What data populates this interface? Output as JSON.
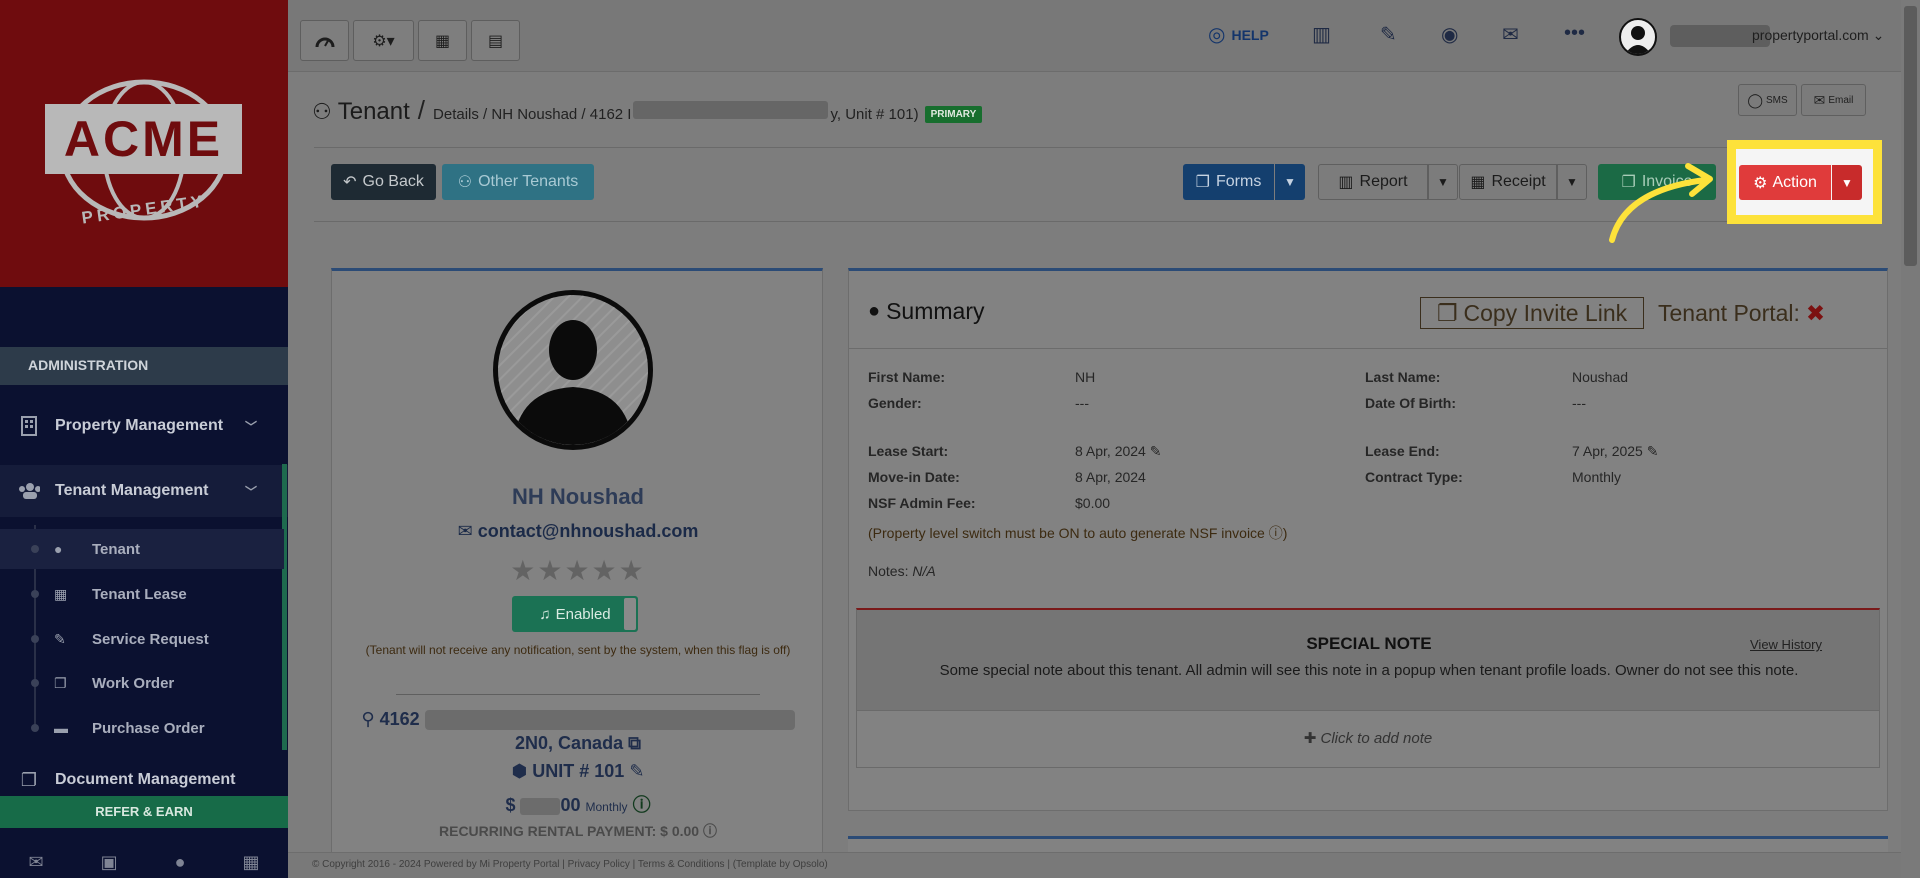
{
  "sidebar": {
    "logo_text": "ACME",
    "logo_sub": "PROPERTY",
    "section_header": "ADMINISTRATION",
    "items": [
      {
        "label": "Property Management",
        "icon": "building-icon"
      },
      {
        "label": "Tenant Management",
        "icon": "users-icon"
      }
    ],
    "sub_items": [
      {
        "label": "Tenant",
        "icon": "user-icon"
      },
      {
        "label": "Tenant Lease",
        "icon": "calendar-check-icon"
      },
      {
        "label": "Service Request",
        "icon": "wrench-icon"
      },
      {
        "label": "Work Order",
        "icon": "copy-icon"
      },
      {
        "label": "Purchase Order",
        "icon": "truck-icon"
      }
    ],
    "doc_mgmt": "Document Management",
    "refer": "REFER & EARN"
  },
  "topbar": {
    "help": "HELP",
    "user_email": "propertyportal.com"
  },
  "breadcrumb": {
    "title": "Tenant",
    "sep": "/",
    "path_a": "Details / NH Noushad / 4162 I",
    "path_b": "y, Unit # 101)",
    "badge": "PRIMARY"
  },
  "msg": {
    "sms": "SMS",
    "email": "Email"
  },
  "toolbar": {
    "go_back": "Go Back",
    "other_tenants": "Other Tenants",
    "forms": "Forms",
    "report": "Report",
    "receipt": "Receipt",
    "invoice": "Invoice",
    "action": "Action"
  },
  "profile": {
    "name": "NH Noushad",
    "email": "contact@nhnoushad.com",
    "stars": "★★★★★",
    "enabled": "Enabled",
    "note": "(Tenant will not receive any notification, sent by the system, when this flag is off)",
    "addr_a": "4162",
    "addr_b": "2N0, Canada",
    "unit": "UNIT # 101",
    "rent_a": "$",
    "rent_b": "00",
    "rent_freq": "Monthly",
    "recurring": "RECURRING RENTAL PAYMENT: $ 0.00"
  },
  "summary": {
    "title": "Summary",
    "copy_invite": "Copy Invite Link",
    "tenant_portal": "Tenant Portal:",
    "first_name_l": "First Name:",
    "first_name_v": "NH",
    "last_name_l": "Last Name:",
    "last_name_v": "Noushad",
    "gender_l": "Gender:",
    "gender_v": "---",
    "dob_l": "Date Of Birth:",
    "dob_v": "---",
    "lease_start_l": "Lease Start:",
    "lease_start_v": "8 Apr, 2024",
    "lease_end_l": "Lease End:",
    "lease_end_v": "7 Apr, 2025",
    "movein_l": "Move-in Date:",
    "movein_v": "8 Apr, 2024",
    "contract_l": "Contract Type:",
    "contract_v": "Monthly",
    "nsf_l": "NSF Admin Fee:",
    "nsf_v": "$0.00",
    "nsf_note": "(Property level switch must be ON to auto generate NSF invoice",
    "notes_l": "Notes:",
    "notes_v": "N/A"
  },
  "special": {
    "title": "SPECIAL NOTE",
    "history": "View History",
    "text": "Some special note about this tenant. All admin will see this note in a popup when tenant profile loads. Owner do not see this note.",
    "add": "Click to add note"
  },
  "footer": "© Copyright 2016 - 2024 Powered by Mi Property Portal | Privacy Policy | Terms & Conditions | (Template by Opsolo)"
}
